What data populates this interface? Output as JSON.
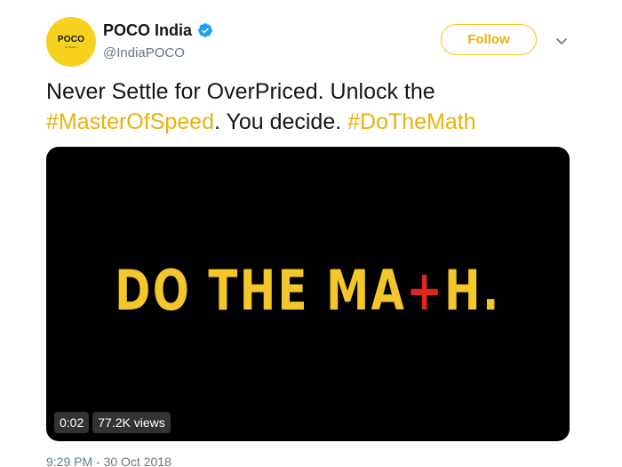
{
  "header": {
    "avatar_label": "POCO",
    "avatar_sublabel": "by Xiaomi",
    "display_name": "POCO India",
    "handle": "@IndiaPOCO",
    "follow_label": "Follow",
    "verified_icon": "verified-badge-icon",
    "caret_icon": "chevron-down-icon"
  },
  "tweet": {
    "text_part1": "Never Settle for OverPriced. Unlock the ",
    "hashtag1": "#MasterOfSpeed",
    "text_part2": ". You decide. ",
    "hashtag2": "#DoTheMath"
  },
  "media": {
    "headline_part1": "DO THE MA",
    "headline_plus": "+",
    "headline_part2": "H.",
    "duration": "0:02",
    "views": "77.2K views"
  },
  "timestamp": "9:29 PM - 30 Oct 2018",
  "colors": {
    "brand_yellow": "#f3c62b",
    "hashtag": "#e8b10c",
    "plus_red": "#e1261c",
    "verified_blue": "#1da1f2",
    "handle_gray": "#657786"
  }
}
